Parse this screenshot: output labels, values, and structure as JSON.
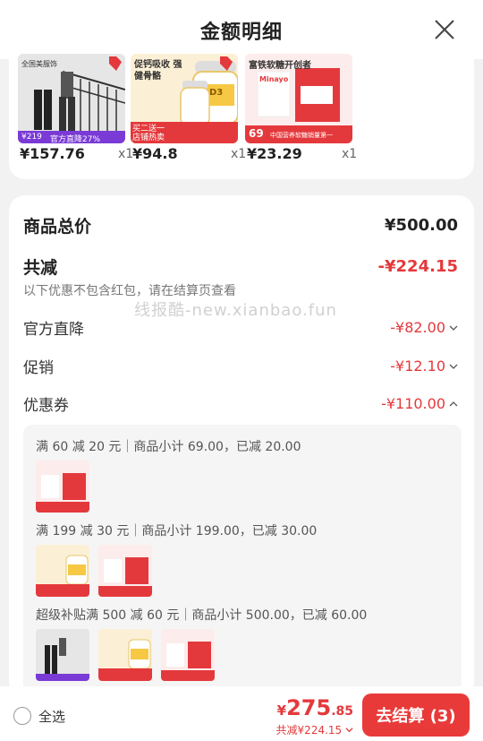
{
  "header": {
    "title": "金额明细",
    "close_icon": "close-icon"
  },
  "products": [
    {
      "price": "¥157.76",
      "qty": "x1",
      "badge_price": "¥219",
      "badge_text": "官方直降27%",
      "thumb_text": "全国美服饰"
    },
    {
      "price": "¥94.8",
      "qty": "x1",
      "badge_text": "买二送一 店铺热卖",
      "thumb_text": "促钙吸收 强健骨骼",
      "sub_text": "D3"
    },
    {
      "price": "¥23.29",
      "qty": "x1",
      "badge_price": "69",
      "badge_text": "中国营养软糖销量第一",
      "thumb_text": "富铁软糖开创者",
      "brand": "Minayo"
    }
  ],
  "summary": {
    "total_label": "商品总价",
    "total_value": "¥500.00",
    "discount_label": "共减",
    "discount_value": "-¥224.15",
    "discount_note": "以下优惠不包含红包，请在结算页查看",
    "items": [
      {
        "label": "官方直降",
        "value": "-¥82.00"
      },
      {
        "label": "促销",
        "value": "-¥12.10"
      },
      {
        "label": "优惠券",
        "value": "-¥110.00"
      }
    ]
  },
  "coupons": [
    {
      "text": "满 60 减 20 元｜商品小计 69.00，已减 20.00"
    },
    {
      "text": "满 199 减 30 元｜商品小计 199.00，已减 30.00"
    },
    {
      "text": "超级补贴满 500 减 60 元｜商品小计 500.00，已减 60.00"
    }
  ],
  "watermark": "线报酷-new.xianbao.fun",
  "bottom": {
    "select_all": "全选",
    "price_symbol": "¥",
    "price_int": "275",
    "price_dec": ".85",
    "saved": "共减¥224.15",
    "checkout": "去结算 (3)"
  },
  "colors": {
    "accent": "#e93a3a",
    "discount": "#e4393c"
  }
}
